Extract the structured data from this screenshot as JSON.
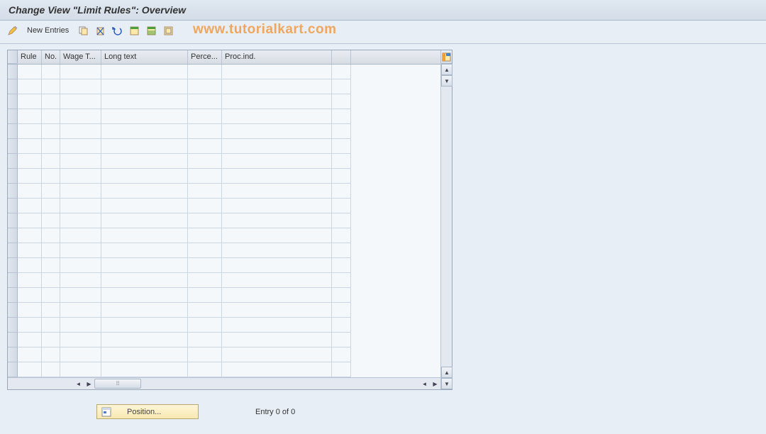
{
  "title": "Change View \"Limit Rules\": Overview",
  "watermark": "www.tutorialkart.com",
  "toolbar": {
    "newEntries": "New Entries"
  },
  "columns": {
    "rule": "Rule",
    "no": "No.",
    "wage": "Wage T...",
    "long": "Long text",
    "perc": "Perce...",
    "proc": "Proc.ind."
  },
  "footer": {
    "position": "Position...",
    "entry": "Entry 0 of 0"
  },
  "rowCount": 21
}
